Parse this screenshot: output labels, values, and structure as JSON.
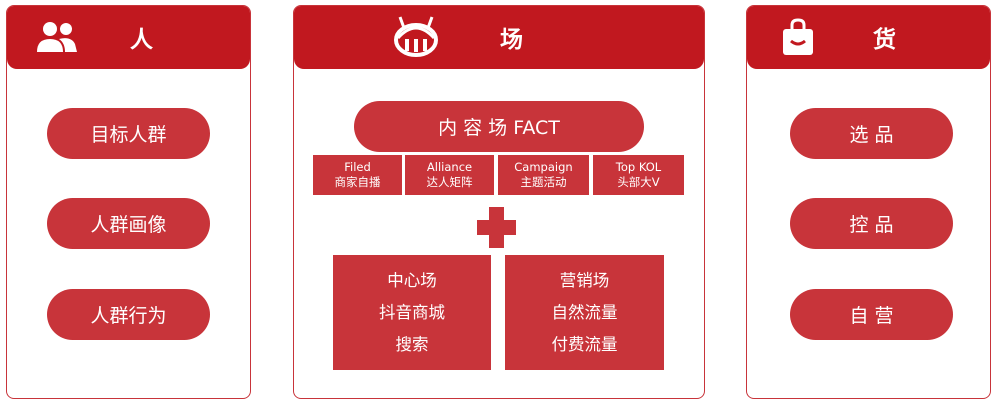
{
  "panels": {
    "people": {
      "title": "人",
      "icon": "people-icon",
      "items": [
        "目标人群",
        "人群画像",
        "人群行为"
      ]
    },
    "field": {
      "title": "场",
      "icon": "stadium-icon",
      "content_field": "内 容 场 FACT",
      "sub_items": [
        {
          "en": "Filed",
          "zh": "商家自播"
        },
        {
          "en": "Alliance",
          "zh": "达人矩阵"
        },
        {
          "en": "Campaign",
          "zh": "主题活动"
        },
        {
          "en": "Top KOL",
          "zh": "头部大V"
        }
      ],
      "center_box": [
        "中心场",
        "抖音商城",
        "搜索"
      ],
      "marketing_box": [
        "营销场",
        "自然流量",
        "付费流量"
      ]
    },
    "goods": {
      "title": "货",
      "icon": "shopping-bag-icon",
      "items": [
        "选 品",
        "控 品",
        "自 营"
      ]
    }
  },
  "colors": {
    "header": "#c1181f",
    "accent": "#c8343a",
    "background": "#ffffff"
  }
}
